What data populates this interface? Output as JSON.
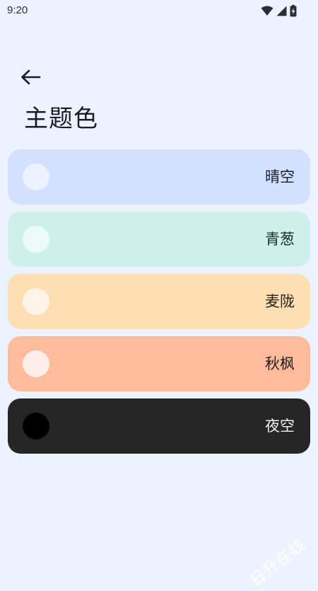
{
  "status_bar": {
    "time": "9:20",
    "icons": [
      "wifi-icon",
      "cellular-signal-icon",
      "battery-charging-icon"
    ]
  },
  "header": {
    "back_icon": "arrow-left-icon",
    "title": "主题色"
  },
  "themes": [
    {
      "label": "晴空",
      "bg": "#D3E1FE",
      "swatch": "#EDF3FE",
      "text": "#1A1C2A"
    },
    {
      "label": "青葱",
      "bg": "#CEF0EA",
      "swatch": "#ECFBF8",
      "text": "#1A2A27"
    },
    {
      "label": "麦陇",
      "bg": "#FEDFB4",
      "swatch": "#FFF3EA",
      "text": "#2A2218"
    },
    {
      "label": "秋枫",
      "bg": "#FFBC9D",
      "swatch": "#FFEDE8",
      "text": "#2A1D17"
    },
    {
      "label": "夜空",
      "bg": "#262626",
      "swatch": "#000000",
      "text": "#F2F2F2"
    }
  ],
  "watermark": "日升在线"
}
